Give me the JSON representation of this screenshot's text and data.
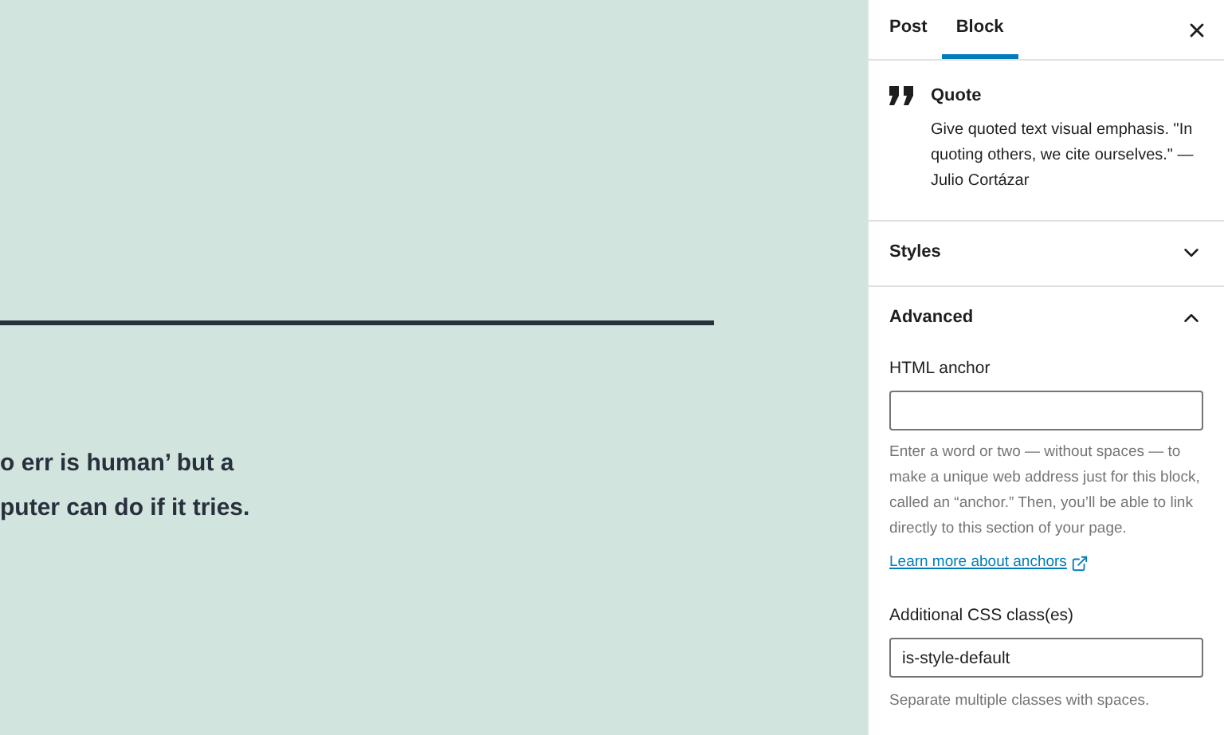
{
  "canvas": {
    "quote_lines": [
      "o err is human’ but a",
      "puter can do if it tries."
    ]
  },
  "sidebar": {
    "tabs": [
      {
        "label": "Post",
        "selected": false
      },
      {
        "label": "Block",
        "selected": true
      }
    ],
    "block_card": {
      "title": "Quote",
      "description": "Give quoted text visual emphasis. \"In quoting others, we cite ourselves.\" — Julio Cortázar"
    },
    "panels": [
      {
        "title": "Styles",
        "expanded": false
      },
      {
        "title": "Advanced",
        "expanded": true
      }
    ],
    "advanced": {
      "anchor_label": "HTML anchor",
      "anchor_help": "Enter a word or two — without spaces — to make a unique web address just for this block, called an “anchor.” Then, you’ll be able to link directly to this section of your page.",
      "learn_more": "Learn more about anchors",
      "css_label": "Additional CSS class(es)",
      "css_value": "is-style-default",
      "css_help": "Separate multiple classes with spaces."
    }
  }
}
